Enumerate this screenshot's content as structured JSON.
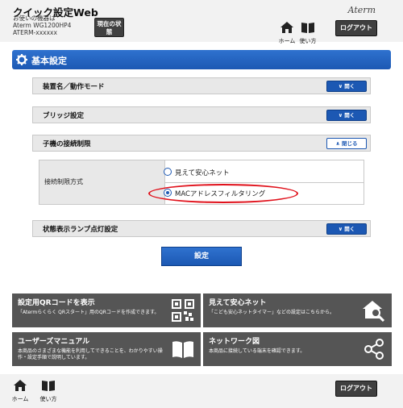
{
  "header": {
    "app_title": "クイック設定Web",
    "device_label": "お使いの機器は",
    "model": "Aterm WG1200HP4",
    "ssid": "ATERM-xxxxxx",
    "status_button": "現在の状態",
    "brand": "Aterm",
    "home_label": "ホーム",
    "help_label": "使い方",
    "logout": "ログアウト"
  },
  "section": {
    "title": "基本設定"
  },
  "panels": [
    {
      "label": "装置名／動作モード",
      "toggle": "開く"
    },
    {
      "label": "ブリッジ設定",
      "toggle": "開く"
    },
    {
      "label": "子機の接続制限",
      "toggle": "閉じる"
    },
    {
      "label": "状態表示ランプ点灯設定",
      "toggle": "開く"
    }
  ],
  "restriction": {
    "label": "接続制限方式",
    "options": [
      "見えて安心ネット",
      "MACアドレスフィルタリング"
    ],
    "selected": "MACアドレスフィルタリング"
  },
  "submit": "設定",
  "tiles": [
    {
      "title": "設定用QRコードを表示",
      "desc": "「Atermらくらく QRスタート」用のQRコードを作成できます。",
      "icon": "qr-code-icon"
    },
    {
      "title": "見えて安心ネット",
      "desc": "「こども安心ネットタイマー」などの設定はこちらから。",
      "icon": "home-search-icon"
    },
    {
      "title": "ユーザーズマニュアル",
      "desc": "本商品のさまざまな機能を利用してできることを、わかりやすい操作・設定手順で説明しています。",
      "icon": "book-icon"
    },
    {
      "title": "ネットワーク図",
      "desc": "本商品に接続している端末を確認できます。",
      "icon": "share-network-icon"
    }
  ],
  "footer": {
    "home_label": "ホーム",
    "help_label": "使い方",
    "logout": "ログアウト"
  },
  "colors": {
    "accent": "#1c58b3",
    "tile": "#555555",
    "highlight": "#e0101a"
  }
}
